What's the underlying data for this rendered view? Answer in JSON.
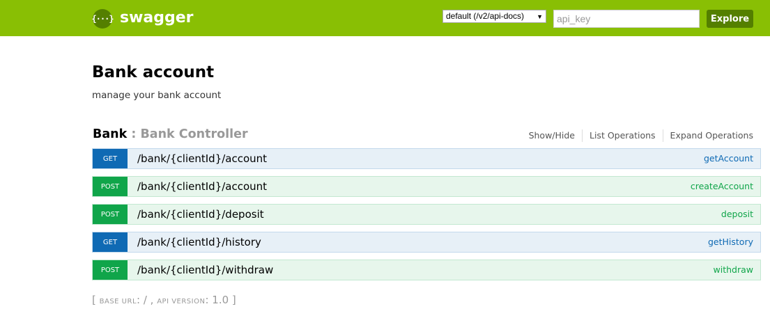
{
  "header": {
    "logo_symbol": "{···}",
    "logo_text": "swagger",
    "api_select_value": "default (/v2/api-docs)",
    "api_key_placeholder": "api_key",
    "explore_label": "Explore",
    "brand_color": "#89bf04",
    "button_color": "#547f00"
  },
  "info": {
    "title": "Bank account",
    "description": "manage your bank account"
  },
  "resource": {
    "name": "Bank",
    "separator": " : ",
    "description": "Bank Controller",
    "options": {
      "show_hide": "Show/Hide",
      "list_operations": "List Operations",
      "expand_operations": "Expand Operations"
    }
  },
  "operations": [
    {
      "method": "GET",
      "path": "/bank/{clientId}/account",
      "nickname": "getAccount"
    },
    {
      "method": "POST",
      "path": "/bank/{clientId}/account",
      "nickname": "createAccount"
    },
    {
      "method": "POST",
      "path": "/bank/{clientId}/deposit",
      "nickname": "deposit"
    },
    {
      "method": "GET",
      "path": "/bank/{clientId}/history",
      "nickname": "getHistory"
    },
    {
      "method": "POST",
      "path": "/bank/{clientId}/withdraw",
      "nickname": "withdraw"
    }
  ],
  "footer": {
    "open_bracket": "[ ",
    "base_url_label": "BASE URL",
    "base_url_value": ": / , ",
    "api_version_label": "API VERSION",
    "api_version_value": ": 1.0 ",
    "close_bracket": "]"
  },
  "colors": {
    "get": "#0f6ab4",
    "post": "#10a54a"
  }
}
